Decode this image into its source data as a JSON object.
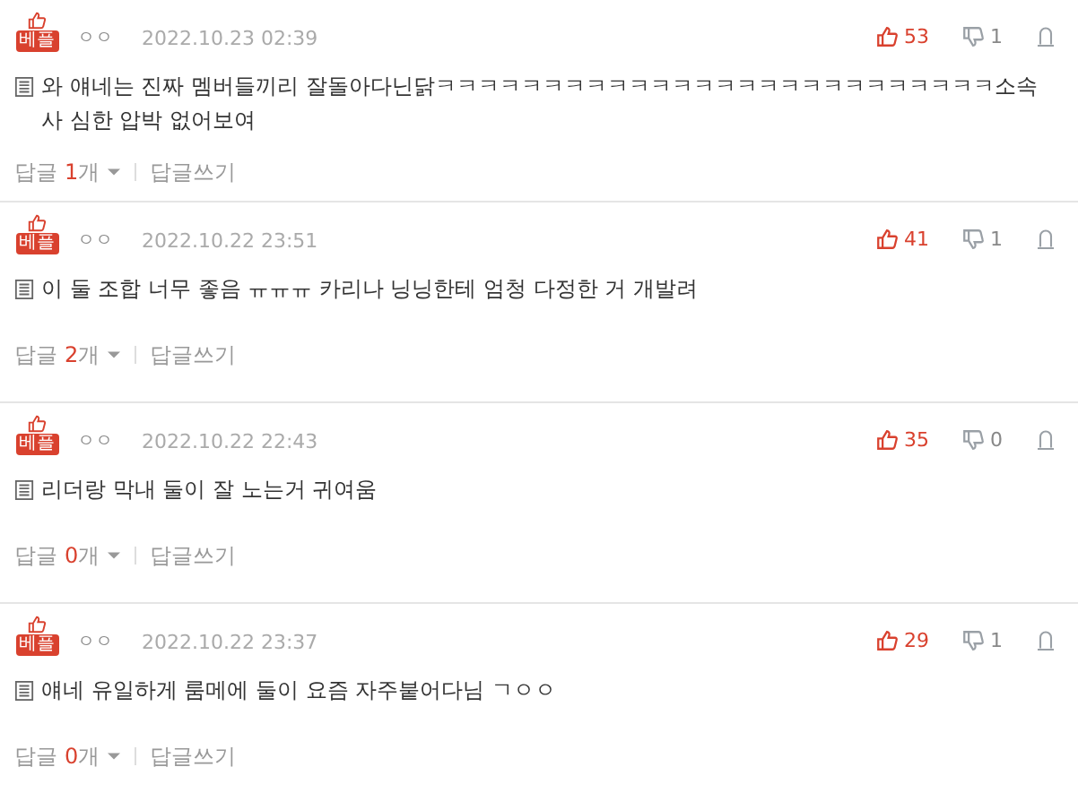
{
  "comments": [
    {
      "badge": "베플",
      "nickname": "ㅇㅇ",
      "date": "2022.10.23 02:39",
      "likes": "53",
      "dislikes": "1",
      "text": "와 얘네는 진짜 멤버들끼리 잘돌아다닌닭ㅋㅋㅋㅋㅋㅋㅋㅋㅋㅋㅋㅋㅋㅋㅋㅋㅋㅋㅋㅋㅋㅋㅋㅋㅋㅋ소속사 심한 압박 없어보여",
      "reply_label": "답글",
      "reply_count": "1",
      "reply_unit": "개",
      "write_reply": "답글쓰기"
    },
    {
      "badge": "베플",
      "nickname": "ㅇㅇ",
      "date": "2022.10.22 23:51",
      "likes": "41",
      "dislikes": "1",
      "text": "이 둘 조합 너무 좋음 ㅠㅠㅠ 카리나 닝닝한테 엄청 다정한 거 개발려",
      "reply_label": "답글",
      "reply_count": "2",
      "reply_unit": "개",
      "write_reply": "답글쓰기"
    },
    {
      "badge": "베플",
      "nickname": "ㅇㅇ",
      "date": "2022.10.22 22:43",
      "likes": "35",
      "dislikes": "0",
      "text": "리더랑 막내 둘이 잘 노는거 귀여움",
      "reply_label": "답글",
      "reply_count": "0",
      "reply_unit": "개",
      "write_reply": "답글쓰기"
    },
    {
      "badge": "베플",
      "nickname": "ㅇㅇ",
      "date": "2022.10.22 23:37",
      "likes": "29",
      "dislikes": "1",
      "text": "얘네 유일하게 룸메에 둘이 요즘 자주붙어다님 ㄱㅇㅇ",
      "reply_label": "답글",
      "reply_count": "0",
      "reply_unit": "개",
      "write_reply": "답글쓰기"
    }
  ]
}
